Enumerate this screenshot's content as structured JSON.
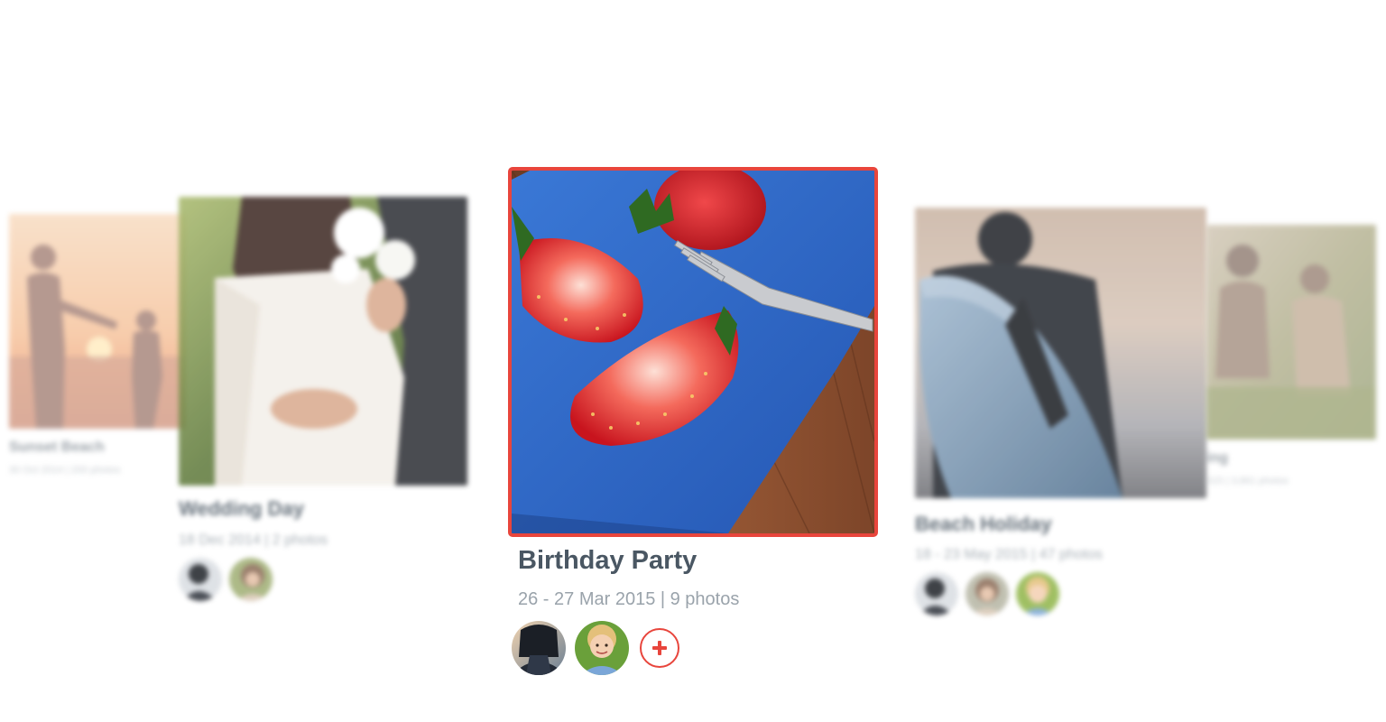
{
  "albums": {
    "far_left": {
      "title": "Sunset Beach",
      "meta": "30 Oct 2014 | 200 photos",
      "photo": "sunset-silhouette-photo"
    },
    "left": {
      "title": "Wedding Day",
      "meta": "18 Dec 2014 | 2 photos",
      "photo": "wedding-couple-photo",
      "people": [
        "person-avatar-dark",
        "person-avatar-woman"
      ]
    },
    "center": {
      "title": "Birthday Party",
      "meta": "26 - 27 Mar 2015 | 9 photos",
      "photo": "strawberries-photo",
      "people": [
        "person-avatar-hooded",
        "person-avatar-child"
      ],
      "add_label": "+",
      "accent_color": "#e8453c"
    },
    "right": {
      "title": "Beach Holiday",
      "meta": "18 - 23 May 2015 | 47 photos",
      "photo": "surfer-photo",
      "people": [
        "person-avatar-dark",
        "person-avatar-woman",
        "person-avatar-child"
      ]
    },
    "far_right": {
      "title": "ing",
      "meta": "015 | 3,861 photos",
      "photo": "friends-outdoor-photo"
    }
  },
  "colors": {
    "title": "#4a5763",
    "meta": "#9aa3ab",
    "accent": "#e8453c",
    "background": "#ffffff"
  }
}
